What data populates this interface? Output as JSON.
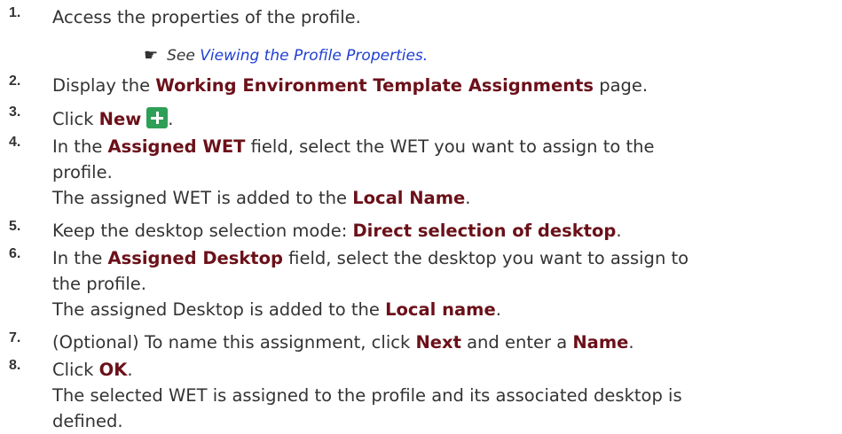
{
  "steps": [
    {
      "num": "1.",
      "parts": [
        {
          "t": "Access the properties of the profile."
        }
      ]
    },
    {
      "num": "2.",
      "parts": [
        {
          "t": "Display the "
        },
        {
          "t": "Working Environment Template Assignments",
          "b": true
        },
        {
          "t": " page."
        }
      ]
    },
    {
      "num": "3.",
      "parts": [
        {
          "t": "Click "
        },
        {
          "t": "New",
          "b": true
        }
      ]
    },
    {
      "num": "4.",
      "parts": [
        {
          "t": "In the "
        },
        {
          "t": "Assigned WET",
          "b": true
        },
        {
          "t": " field, select the WET you want to assign to the"
        }
      ],
      "cont": [
        {
          "t": "profile."
        }
      ],
      "note": [
        {
          "t": "The assigned WET is added to the "
        },
        {
          "t": "Local Name",
          "b": true
        },
        {
          "t": "."
        }
      ]
    },
    {
      "num": "5.",
      "parts": [
        {
          "t": "Keep the desktop selection mode: "
        },
        {
          "t": "Direct selection of desktop",
          "b": true
        },
        {
          "t": "."
        }
      ]
    },
    {
      "num": "6.",
      "parts": [
        {
          "t": "In the "
        },
        {
          "t": "Assigned Desktop",
          "b": true
        },
        {
          "t": " field, select the desktop you want to assign to"
        }
      ],
      "cont": [
        {
          "t": "the profile."
        }
      ],
      "note": [
        {
          "t": "The assigned Desktop is added to the "
        },
        {
          "t": "Local name",
          "b": true
        },
        {
          "t": "."
        }
      ]
    },
    {
      "num": "7.",
      "parts": [
        {
          "t": "(Optional) To name this assignment, click "
        },
        {
          "t": "Next",
          "b": true
        },
        {
          "t": " and enter a "
        },
        {
          "t": "Name",
          "b": true
        },
        {
          "t": "."
        }
      ]
    },
    {
      "num": "8.",
      "parts": [
        {
          "t": "Click "
        },
        {
          "t": "OK",
          "b": true
        },
        {
          "t": "."
        }
      ],
      "note": [
        {
          "t": "The selected WET is assigned to the profile and its associated desktop is"
        }
      ],
      "note2": [
        {
          "t": "defined."
        }
      ]
    }
  ],
  "see_ref": {
    "prefix": "See ",
    "link": "Viewing the Profile Properties."
  },
  "icons": {
    "new_button": "plus-icon",
    "see_marker": "pointing-hand-icon"
  },
  "colors": {
    "keyword": "#6b1019",
    "link": "#1f3fd1",
    "new_icon_bg": "#2e9f57"
  }
}
